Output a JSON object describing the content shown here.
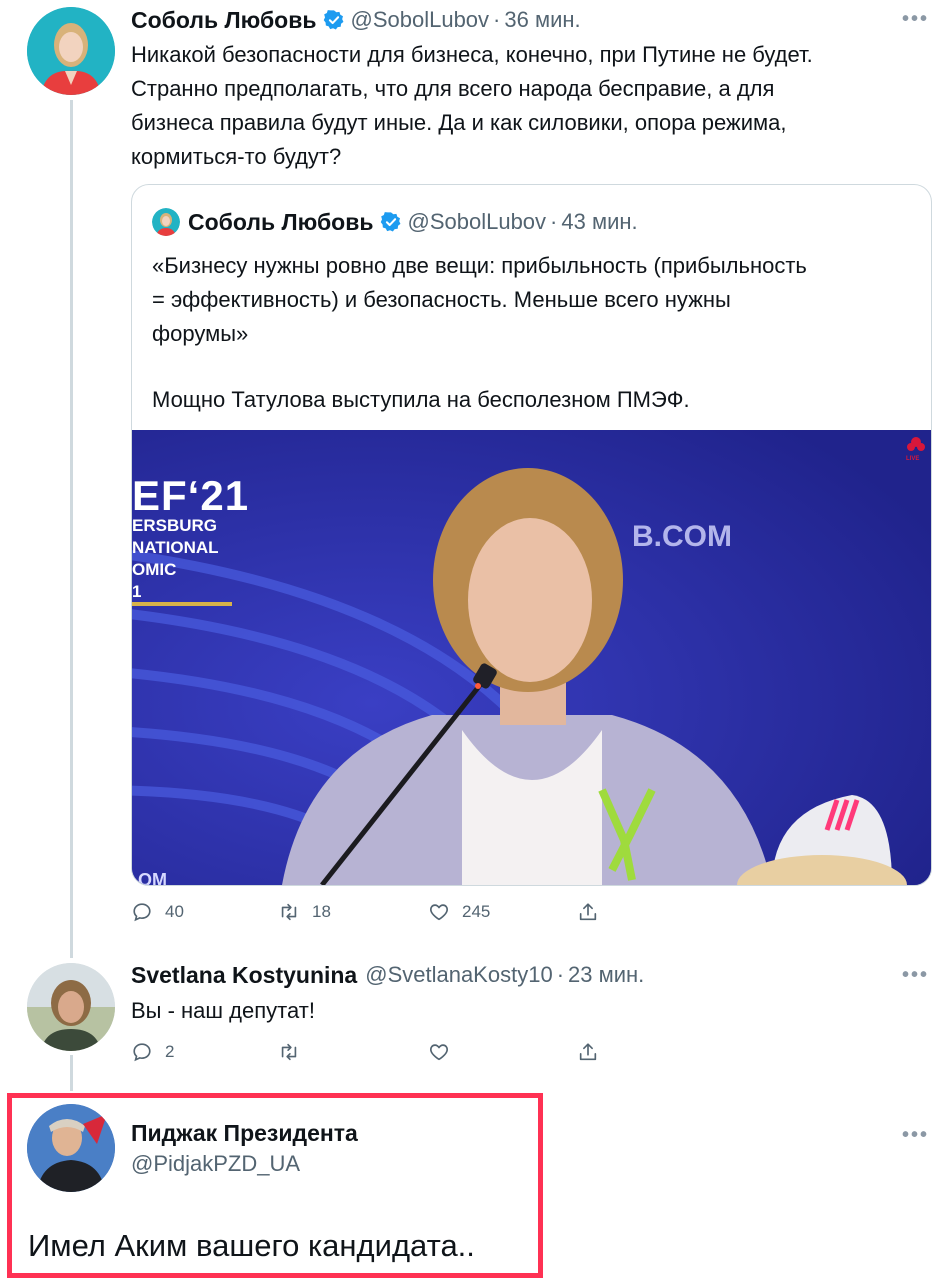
{
  "tweet1": {
    "name": "Соболь Любовь",
    "handle": "@SobolLubov",
    "time": "36 мин.",
    "lines": [
      "Никакой безопасности для бизнеса, конечно, при Путине не будет.",
      "Странно предполагать, что для всего народа бесправие, а для",
      "бизнеса правила будут иные. Да и  как силовики, опора режима,",
      "кормиться-то будут?"
    ],
    "quote": {
      "name": "Соболь Любовь",
      "handle": "@SobolLubov",
      "time": "43 мин.",
      "lines": [
        "«Бизнесу нужны ровно две вещи:  прибыльность (прибыльность",
        "= эффективность) и безопасность. Меньше всего нужны",
        "форумы»",
        "Мощно Татулова выступила на бесполезном ПМЭФ."
      ],
      "image_text": {
        "event": "EF‘21",
        "line1": "ERSBURG",
        "line2": "NATIONAL",
        "line3": "OMIC",
        "line4": "1",
        "site": "B.COM",
        "bottom": "ОМ",
        "channel": "LIVE"
      }
    },
    "actions": {
      "replies": "40",
      "retweets": "18",
      "likes": "245"
    }
  },
  "tweet2": {
    "name": "Svetlana Kostyunina",
    "handle": "@SvetlanaKosty10",
    "time": "23 мин.",
    "text": "Вы - наш депутат!",
    "actions": {
      "replies": "2"
    }
  },
  "tweet3": {
    "name": "Пиджак Президента",
    "handle": "@PidjakPZD_UA",
    "text": "Имел Аким вашего кандидата.."
  },
  "separator": "·",
  "more_glyph": "•••",
  "colors": {
    "verified": "#1d9bf0",
    "highlight": "#ff3153",
    "text_secondary": "#536471"
  }
}
